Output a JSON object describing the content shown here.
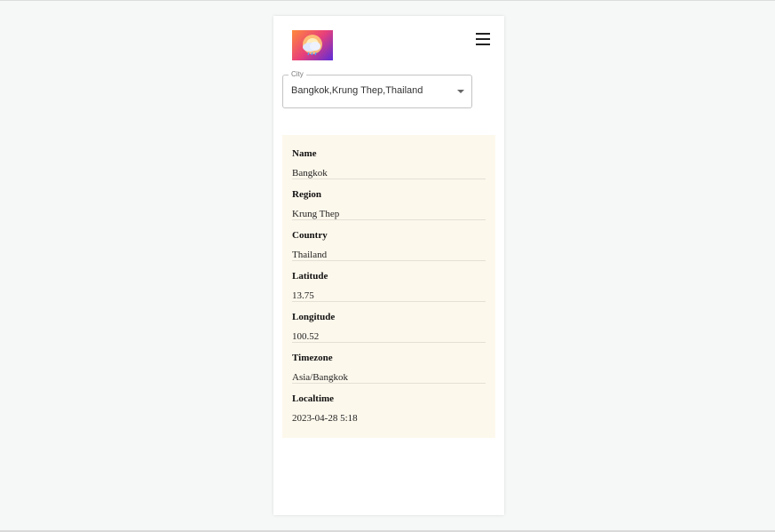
{
  "city_select": {
    "label": "City",
    "value": "Bangkok,Krung Thep,Thailand"
  },
  "location": [
    {
      "label": "Name",
      "value": "Bangkok"
    },
    {
      "label": "Region",
      "value": "Krung Thep"
    },
    {
      "label": "Country",
      "value": "Thailand"
    },
    {
      "label": "Latitude",
      "value": "13.75"
    },
    {
      "label": "Longitude",
      "value": "100.52"
    },
    {
      "label": "Timezone",
      "value": "Asia/Bangkok"
    },
    {
      "label": "Localtime",
      "value": "2023-04-28 5:18"
    }
  ],
  "icons": {
    "logo": "weather-cloud-logo",
    "menu": "hamburger-menu-icon",
    "dropdown": "chevron-down-icon"
  },
  "colors": {
    "page_background": "#f6f7f7",
    "card_background": "#ffffff",
    "info_panel_background": "#fdf8ec",
    "logo_gradient": [
      "#ff8a3c",
      "#e8407a",
      "#5b2bd9"
    ]
  }
}
